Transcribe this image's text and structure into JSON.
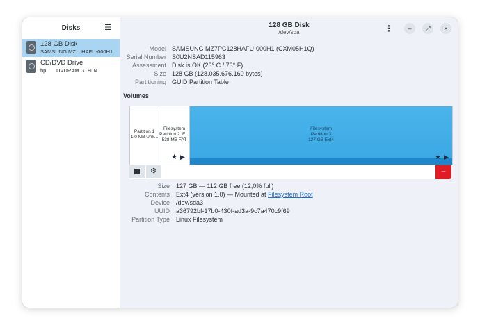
{
  "sidebar": {
    "title": "Disks",
    "menu_icon": "hamburger-menu-icon",
    "devices": [
      {
        "name": "128 GB Disk",
        "sub": "SAMSUNG MZ... HAFU-000H1",
        "sub2": "",
        "icon": "harddisk-icon",
        "selected": true
      },
      {
        "name": "CD/DVD Drive",
        "sub": "hp",
        "sub2": "DVDRAM GT80N",
        "icon": "optical-drive-icon",
        "selected": false
      }
    ]
  },
  "header": {
    "title": "128 GB Disk",
    "subtitle": "/dev/sda",
    "menu_icon": "kebab-menu-icon",
    "minimize": "–",
    "maximize": "⤢",
    "close": "×"
  },
  "disk_info": [
    {
      "label": "Model",
      "value": "SAMSUNG MZ7PC128HAFU-000H1 (CXM05H1Q)"
    },
    {
      "label": "Serial Number",
      "value": "S0U2NSAD115963"
    },
    {
      "label": "Assessment",
      "value": "Disk is OK (23° C / 73° F)"
    },
    {
      "label": "Size",
      "value": "128 GB (128.035.676.160 bytes)"
    },
    {
      "label": "Partitioning",
      "value": "GUID Partition Table"
    }
  ],
  "volumes": {
    "title": "Volumes",
    "partitions": [
      {
        "line1": "Partition 1",
        "line2": "1,0 MB Unk...",
        "line3": ""
      },
      {
        "line1": "Filesystem",
        "line2": "Partition 2: E...",
        "line3": "538 MB FAT"
      },
      {
        "line1": "Filesystem",
        "line2": "Partition 3",
        "line3": "127 GB Ext4"
      }
    ],
    "star_icon": "★",
    "play_icon": "▶"
  },
  "toolbar": {
    "stop_icon": "stop-icon",
    "settings_icon": "gears-icon",
    "delete_label": "−"
  },
  "partition_info": {
    "size_label": "Size",
    "size_value": "127 GB — 112 GB free (12,0% full)",
    "contents_label": "Contents",
    "contents_value": "Ext4 (version 1.0) — Mounted at",
    "contents_link": "Filesystem Root",
    "device_label": "Device",
    "device_value": "/dev/sda3",
    "uuid_label": "UUID",
    "uuid_value": "a36792bf-17b0-430f-ad3a-9c7a470c9f69",
    "type_label": "Partition Type",
    "type_value": "Linux Filesystem"
  },
  "colors": {
    "accent": "#3aa7e4",
    "selection": "#a9d5f2",
    "destructive": "#e01b24"
  }
}
